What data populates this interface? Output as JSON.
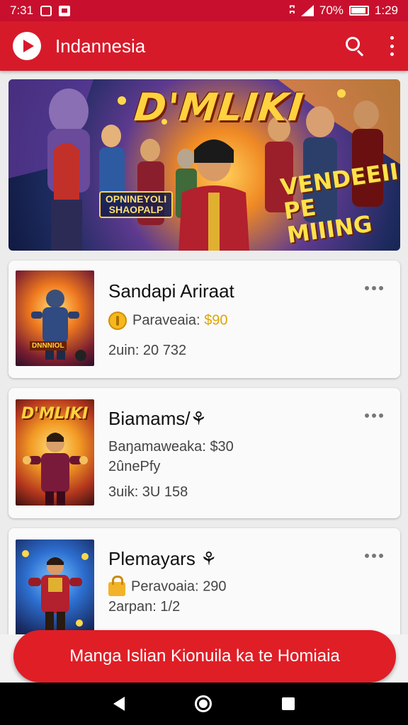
{
  "status_bar": {
    "time_left": "7:31",
    "battery_text": "70%",
    "clock": "1:29"
  },
  "app_bar": {
    "title": "Indannesia",
    "actions": [
      "search-icon",
      "more-vert-icon"
    ]
  },
  "banner": {
    "title": "D'MLIKI",
    "subtitle": "OPNINEYOLI SHAOPALP",
    "tagline_line1": "VENDEEII",
    "tagline_line2": "PE MIIING"
  },
  "items": [
    {
      "title": "Sandapi Ariraat",
      "line1_icon": "coin-icon",
      "line1_label": "Paraveaia:",
      "line1_value": "$90",
      "line2": "",
      "line3": "2uin: 20 732",
      "thumb_text": "DNNNIOL"
    },
    {
      "title": "Biamams/⚘",
      "line1_icon": "",
      "line1_label": "Baŋamaweaka:",
      "line1_value": "$30",
      "line2": "2ûnePfy",
      "line3": "3uik: 3U 158",
      "thumb_text": "D'MLIKI"
    },
    {
      "title": "Plemayars ⚘",
      "line1_icon": "lock-icon",
      "line1_label": "Peravoaia:",
      "line1_value": "290",
      "line2": "2arpan: 1/2",
      "line3": "",
      "thumb_text": ""
    }
  ],
  "cta": {
    "label": "Manga Islian Kionuila ka te Homiaia"
  },
  "colors": {
    "primary": "#d71a2a",
    "status_bar": "#c8102e",
    "cta": "#e01e26",
    "price": "#e0a400"
  }
}
